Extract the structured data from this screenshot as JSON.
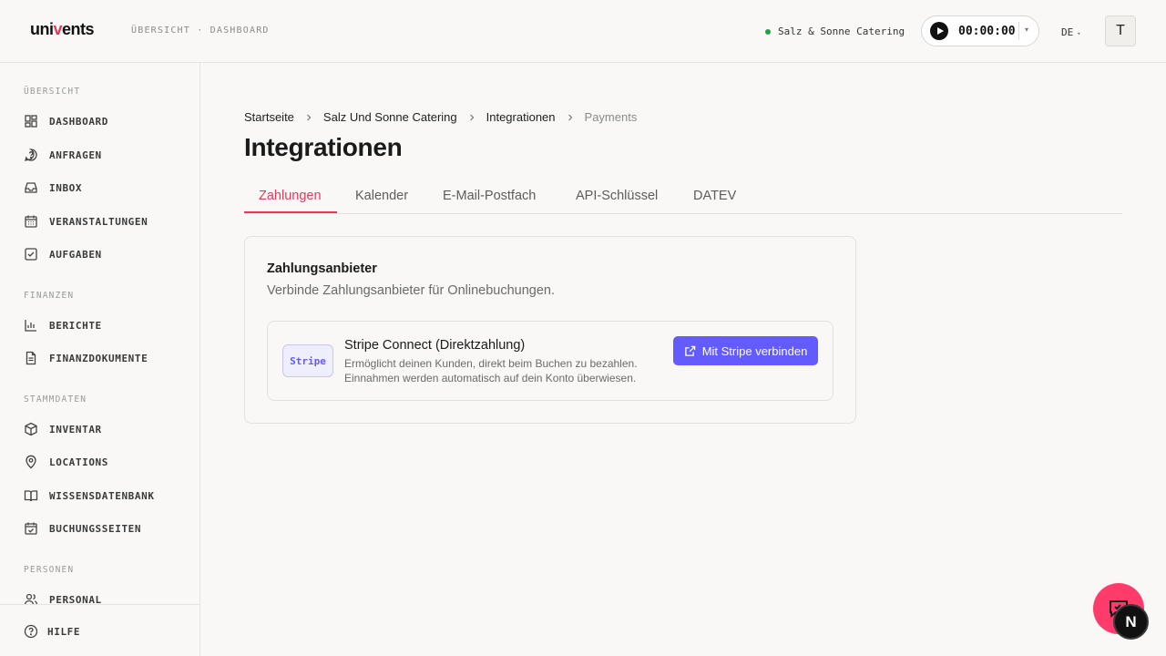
{
  "header": {
    "logo": {
      "prefix": "uni",
      "accent": "v",
      "suffix": "ents"
    },
    "breadcrumb": "ÜBERSICHT · DASHBOARD",
    "organization": "Salz & Sonne Catering",
    "status_color": "#1fa34a",
    "timer": "00:00:00",
    "language": "DE",
    "avatar_initial": "T"
  },
  "sidebar": {
    "sections": [
      {
        "label": "ÜBERSICHT",
        "items": [
          {
            "label": "DASHBOARD",
            "icon": "dashboard-icon"
          },
          {
            "label": "ANFRAGEN",
            "icon": "question-icon"
          },
          {
            "label": "INBOX",
            "icon": "inbox-icon"
          },
          {
            "label": "VERANSTALTUNGEN",
            "icon": "calendar-icon"
          },
          {
            "label": "AUFGABEN",
            "icon": "checkbox-icon"
          }
        ]
      },
      {
        "label": "FINANZEN",
        "items": [
          {
            "label": "BERICHTE",
            "icon": "bar-chart-icon"
          },
          {
            "label": "FINANZDOKUMENTE",
            "icon": "document-icon"
          }
        ]
      },
      {
        "label": "STAMMDATEN",
        "items": [
          {
            "label": "INVENTAR",
            "icon": "box-icon"
          },
          {
            "label": "LOCATIONS",
            "icon": "map-pin-icon"
          },
          {
            "label": "WISSENSDATENBANK",
            "icon": "book-icon"
          },
          {
            "label": "BUCHUNGSSEITEN",
            "icon": "calendar-check-icon"
          }
        ]
      },
      {
        "label": "PERSONEN",
        "items": [
          {
            "label": "PERSONAL",
            "icon": "users-icon"
          }
        ]
      }
    ],
    "help": "HILFE"
  },
  "main": {
    "breadcrumb": [
      "Startseite",
      "Salz Und Sonne Catering",
      "Integrationen",
      "Payments"
    ],
    "title": "Integrationen",
    "tabs": [
      "Zahlungen",
      "Kalender",
      "E-Mail-Postfach",
      "API-Schlüssel",
      "DATEV"
    ],
    "active_tab": "Zahlungen",
    "card": {
      "title": "Zahlungsanbieter",
      "subtitle": "Verbinde Zahlungsanbieter für Onlinebuchungen.",
      "provider": {
        "logo_text": "Stripe",
        "name": "Stripe Connect (Direktzahlung)",
        "description_line1": "Ermöglicht deinen Kunden, direkt beim Buchen zu bezahlen.",
        "description_line2": "Einnahmen werden automatisch auf dein Konto überwiesen.",
        "button": "Mit Stripe verbinden"
      }
    }
  },
  "floating": {
    "badge_letter": "N"
  },
  "colors": {
    "accent": "#e5395c",
    "stripe": "#635bff",
    "chat": "#ff3b6b"
  }
}
